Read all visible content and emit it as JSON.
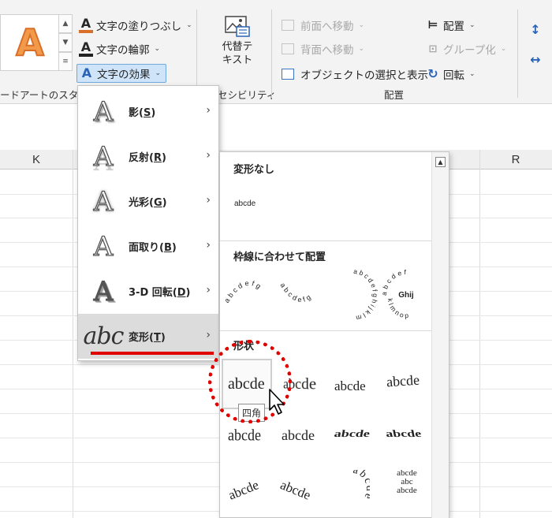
{
  "ribbon": {
    "wordart_letter": "A",
    "text_fill": "文字の塗りつぶし",
    "text_outline": "文字の輪郭",
    "text_effects": "文字の効果",
    "wordart_group": "ードアートのスタイル",
    "alt_text_line1": "代替テ",
    "alt_text_line2": "キスト",
    "accessibility_group": "セシビリティ",
    "bring_forward": "前面へ移動",
    "send_backward": "背面へ移動",
    "selection_pane": "オブジェクトの選択と表示",
    "align": "配置",
    "group": "グループ化",
    "rotate": "回転",
    "arrange_group": "配置"
  },
  "sheet": {
    "col_k": "K",
    "col_r": "R"
  },
  "menu": {
    "items": [
      {
        "label": "影",
        "key": "S"
      },
      {
        "label": "反射",
        "key": "R"
      },
      {
        "label": "光彩",
        "key": "G"
      },
      {
        "label": "面取り",
        "key": "B"
      },
      {
        "label": "3-D 回転",
        "key": "D"
      },
      {
        "label": "変形",
        "key": "T"
      }
    ],
    "abc_icon_text": "abc"
  },
  "submenu": {
    "no_transform_header": "変形なし",
    "no_transform_sample": "abcde",
    "follow_path_header": "枠線に合わせて配置",
    "arc_sample_1": "abcdefg",
    "arc_sample_2": "abcdefg",
    "circle_sample": "abcdefghijklm",
    "button_sample_outer": "abcdef",
    "button_sample_inner": "Ghij",
    "button_sample_lower": "klmnop",
    "warp_header": "形状",
    "warp_samples": [
      "abcde",
      "abcde",
      "abcde",
      "abcde",
      "abcde",
      "abcde",
      "abcde",
      "abcde",
      "abcde",
      "abcde",
      "abcde",
      "abcde"
    ],
    "circle_sample_2": "abcde",
    "stack_line1": "abcde",
    "stack_line2": "abc",
    "stack_line3": "abcde",
    "tooltip": "四角"
  },
  "colors": {
    "accent_orange": "#d9702a",
    "effects_highlight": "#cfe4f8",
    "annotation_red": "#e00000"
  }
}
